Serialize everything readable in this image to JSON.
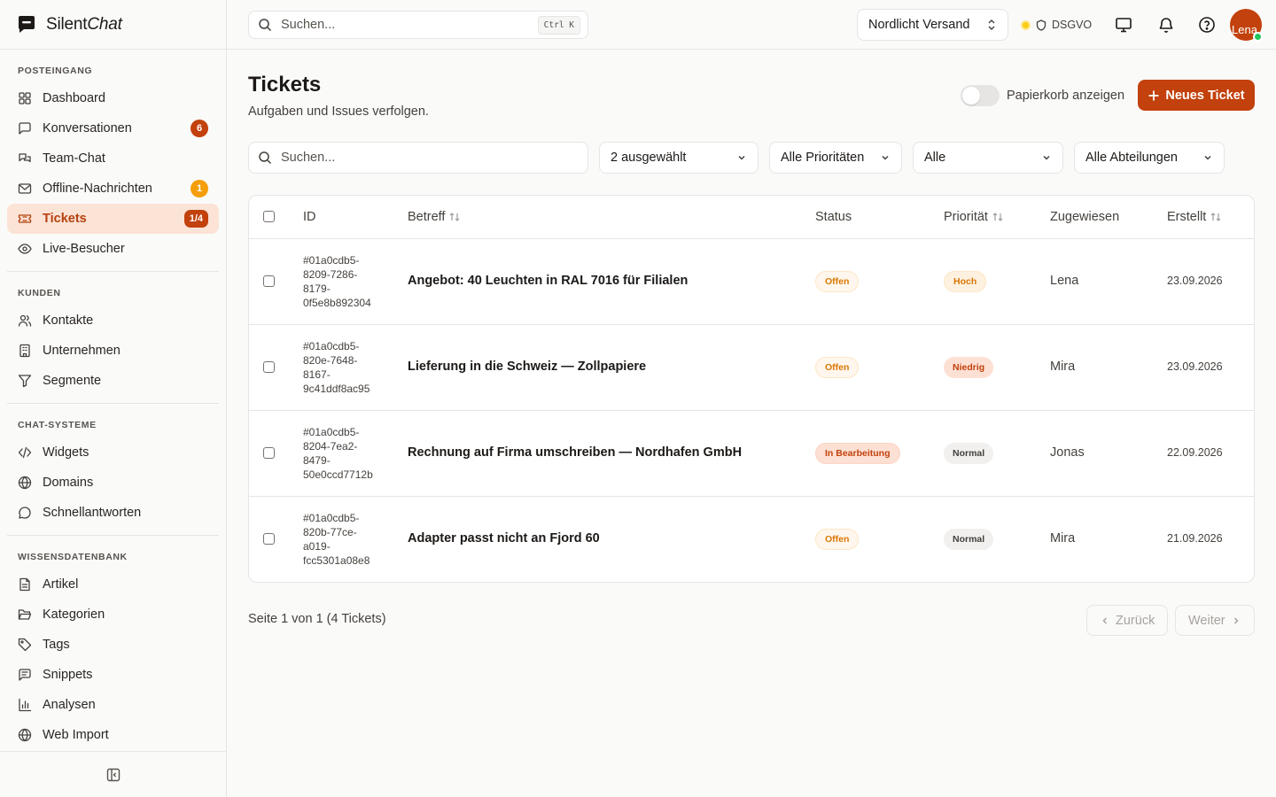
{
  "brand": {
    "name_plain": "Silent",
    "name_italic": "Chat"
  },
  "sidebar": {
    "sections": [
      {
        "title": "POSTEINGANG",
        "items": [
          {
            "label": "Dashboard",
            "icon": "grid-icon"
          },
          {
            "label": "Konversationen",
            "icon": "message-square-icon",
            "badge": "6"
          },
          {
            "label": "Team-Chat",
            "icon": "messages-icon"
          },
          {
            "label": "Offline-Nachrichten",
            "icon": "mail-icon",
            "badge": "1"
          },
          {
            "label": "Tickets",
            "icon": "ticket-icon",
            "badge": "1/4",
            "active": true
          },
          {
            "label": "Live-Besucher",
            "icon": "eye-icon"
          }
        ]
      },
      {
        "title": "KUNDEN",
        "items": [
          {
            "label": "Kontakte",
            "icon": "users-icon"
          },
          {
            "label": "Unternehmen",
            "icon": "building-icon"
          },
          {
            "label": "Segmente",
            "icon": "filter-icon"
          }
        ]
      },
      {
        "title": "CHAT-SYSTEME",
        "items": [
          {
            "label": "Widgets",
            "icon": "code-icon"
          },
          {
            "label": "Domains",
            "icon": "globe-icon"
          },
          {
            "label": "Schnellantworten",
            "icon": "message-circle-icon"
          }
        ]
      },
      {
        "title": "WISSENSDATENBANK",
        "items": [
          {
            "label": "Artikel",
            "icon": "file-text-icon"
          },
          {
            "label": "Kategorien",
            "icon": "folder-open-icon"
          },
          {
            "label": "Tags",
            "icon": "tag-icon"
          },
          {
            "label": "Snippets",
            "icon": "message-square-text-icon"
          },
          {
            "label": "Analysen",
            "icon": "bar-chart-icon"
          },
          {
            "label": "Web Import",
            "icon": "globe-icon"
          }
        ]
      }
    ]
  },
  "topbar": {
    "search_placeholder": "Suchen...",
    "shortcut": "Ctrl K",
    "org": "Nordlicht Versand",
    "compliance": "DSGVO",
    "avatar_label": "Lena"
  },
  "page": {
    "title": "Tickets",
    "subtitle": "Aufgaben und Issues verfolgen.",
    "trash_toggle_label": "Papierkorb anzeigen",
    "trash_toggle_on": false,
    "new_button": "Neues Ticket"
  },
  "filters": {
    "search_placeholder": "Suchen...",
    "status": "2 ausgewählt",
    "priority": "Alle Prioritäten",
    "assignee": "Alle",
    "department": "Alle Abteilungen"
  },
  "table": {
    "headers": {
      "id": "ID",
      "subject": "Betreff",
      "status": "Status",
      "priority": "Priorität",
      "assigned": "Zugewiesen",
      "created": "Erstellt"
    },
    "rows": [
      {
        "id": "#01a0cdb5-8209-7286-8179-0f5e8b892304",
        "id_lines": [
          "#01a0cdb5-",
          "8209-7286-",
          "8179-",
          "0f5e8b892304"
        ],
        "subject": "Angebot: 40 Leuchten in RAL 7016 für Filialen",
        "status": "Offen",
        "status_kind": "offen",
        "priority": "Hoch",
        "priority_kind": "hoch",
        "assigned": "Lena",
        "created": "23.09.2026"
      },
      {
        "id": "#01a0cdb5-820e-7648-8167-9c41ddf8ac95",
        "id_lines": [
          "#01a0cdb5-",
          "820e-7648-",
          "8167-",
          "9c41ddf8ac95"
        ],
        "subject": "Lieferung in die Schweiz — Zollpapiere",
        "status": "Offen",
        "status_kind": "offen",
        "priority": "Niedrig",
        "priority_kind": "niedrig",
        "assigned": "Mira",
        "created": "23.09.2026"
      },
      {
        "id": "#01a0cdb5-8204-7ea2-8479-50e0ccd7712b",
        "id_lines": [
          "#01a0cdb5-",
          "8204-7ea2-",
          "8479-",
          "50e0ccd7712b"
        ],
        "subject": "Rechnung auf Firma umschreiben — Nordhafen GmbH",
        "status": "In Bearbeitung",
        "status_kind": "bearb",
        "priority": "Normal",
        "priority_kind": "normal",
        "assigned": "Jonas",
        "created": "22.09.2026"
      },
      {
        "id": "#01a0cdb5-820b-77ce-a019-fcc5301a08e8",
        "id_lines": [
          "#01a0cdb5-",
          "820b-77ce-",
          "a019-",
          "fcc5301a08e8"
        ],
        "subject": "Adapter passt nicht an Fjord 60",
        "status": "Offen",
        "status_kind": "offen",
        "priority": "Normal",
        "priority_kind": "normal",
        "assigned": "Mira",
        "created": "21.09.2026"
      }
    ]
  },
  "pagination": {
    "info": "Seite 1 von 1 (4 Tickets)",
    "prev": "Zurück",
    "next": "Weiter"
  },
  "colors": {
    "accent": "#c2410c",
    "active_bg": "#fbe3d6",
    "border": "#e7e5e4",
    "badge_amber": "#f59e0b",
    "online": "#22c55e"
  }
}
